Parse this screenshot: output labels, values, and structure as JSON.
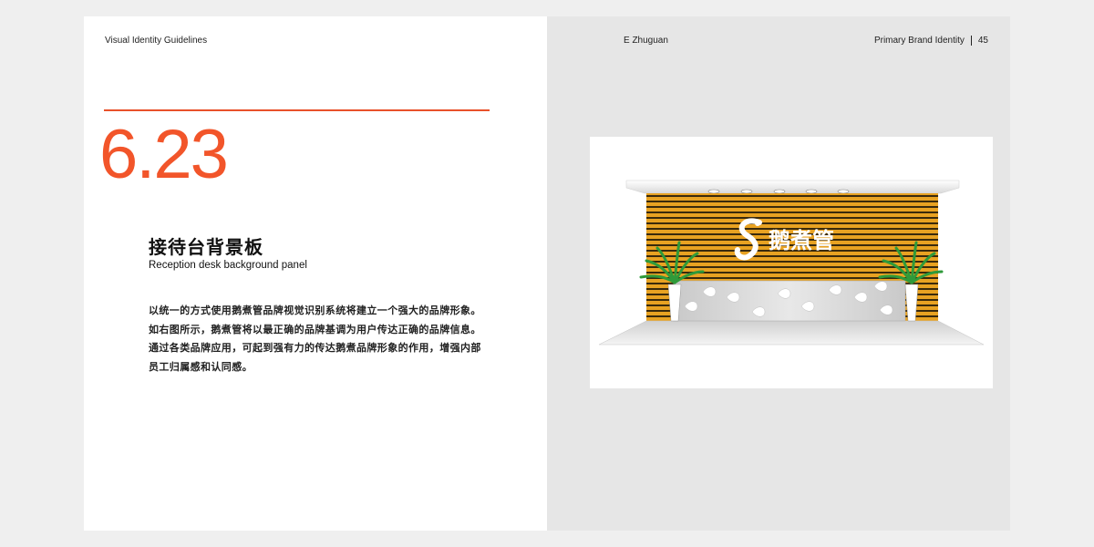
{
  "header": {
    "left": "Visual Identity Guidelines",
    "center": "E Zhuguan",
    "section": "Primary Brand Identity",
    "page_number": "45"
  },
  "section": {
    "number": "6.23",
    "title_cn": "接待台背景板",
    "title_en": "Reception desk background panel"
  },
  "body": {
    "lines": [
      "以统一的方式使用鹅煮管品牌视觉识别系统将建立一个强大的品牌形象。",
      "如右图所示，鹅煮管将以最正确的品牌基调为用户传达正确的品牌信息。",
      "通过各类品牌应用，可起到强有力的传达鹅煮品牌形象的作用，增强内部",
      "员工归属感和认同感。"
    ]
  },
  "illustration": {
    "logo_text": "鹅煮管",
    "colors": {
      "accent": "#f2552a",
      "wood_stripe": "#e8a222",
      "stripe_dark": "#3a2a0c",
      "plant": "#2f9a3a",
      "counter": "#d6d6d6"
    }
  }
}
